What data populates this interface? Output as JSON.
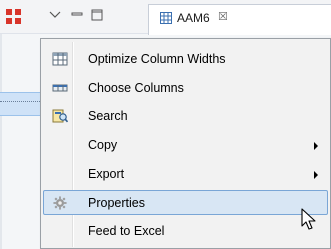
{
  "tab": {
    "label": "AAM6",
    "close_glyph": "☒"
  },
  "toolbar_icons": [
    "grid-icon",
    "chevron-down-icon",
    "minimize-icon",
    "maximize-icon"
  ],
  "context_menu": {
    "items": [
      {
        "label": "Optimize Column Widths",
        "icon": "table-icon",
        "submenu": false
      },
      {
        "label": "Choose Columns",
        "icon": "columns-icon",
        "submenu": false
      },
      {
        "label": "Search",
        "icon": "search-icon",
        "submenu": false
      },
      {
        "label": "Copy",
        "icon": "",
        "submenu": true
      },
      {
        "label": "Export",
        "icon": "",
        "submenu": true
      },
      {
        "label": "Properties",
        "icon": "gear-icon",
        "submenu": false,
        "highlighted": true
      },
      {
        "label": "Feed to Excel",
        "icon": "",
        "submenu": false
      }
    ]
  },
  "colors": {
    "menu_bg": "#f2f2f2",
    "highlight_bg": "#d8e6f4",
    "highlight_border": "#7aa6d6",
    "accent_red": "#d8342a"
  }
}
